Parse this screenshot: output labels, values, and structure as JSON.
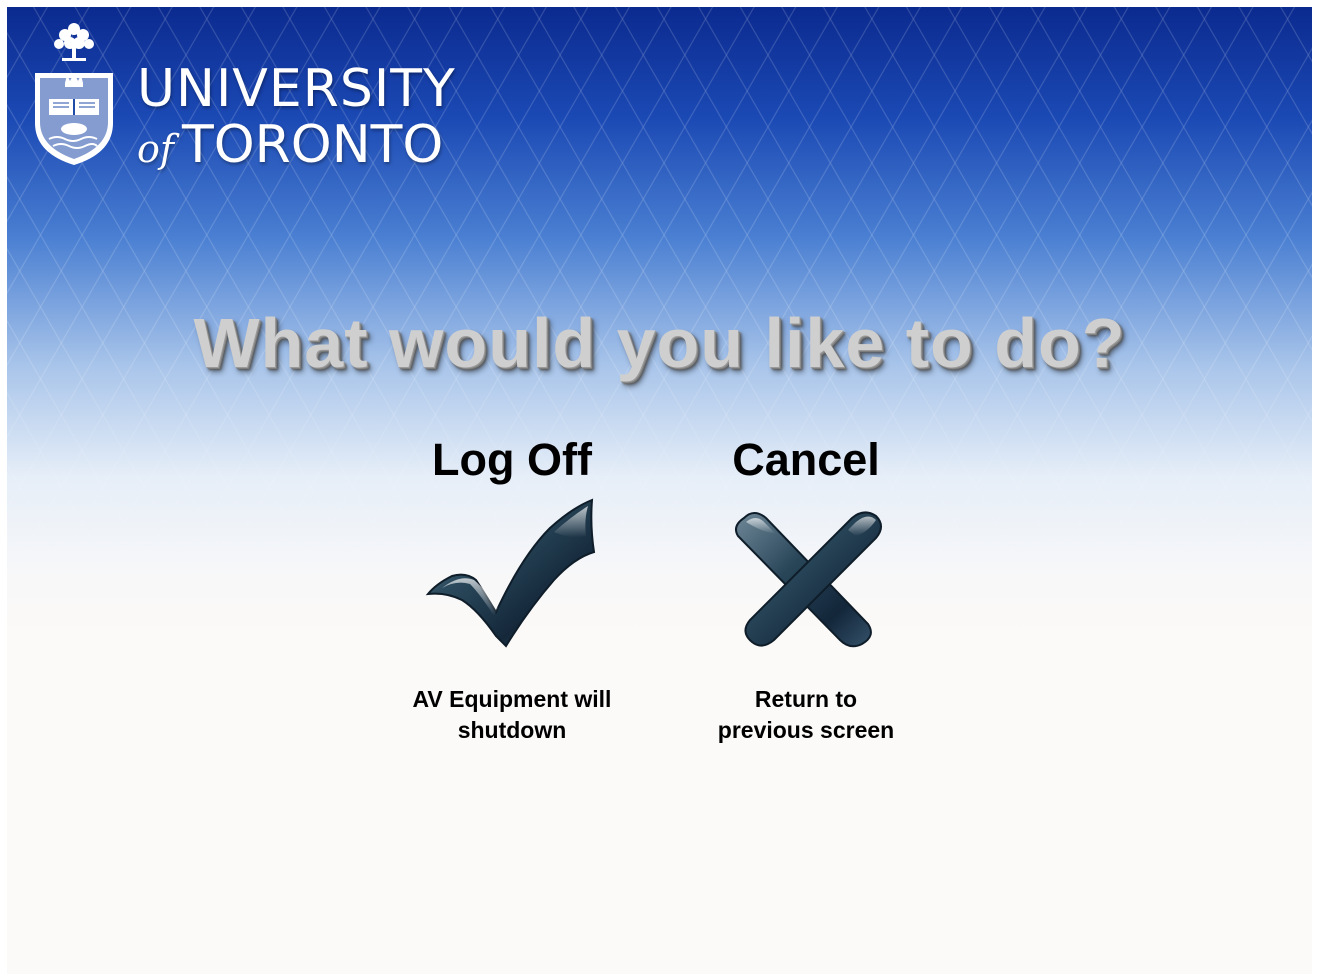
{
  "logo": {
    "line1": "UNIVERSITY",
    "of": "of",
    "line2": "TORONTO",
    "crest_icon": "university-crest-icon",
    "color": "#ffffff"
  },
  "headline": "What would you like to do?",
  "options": [
    {
      "title": "Log Off",
      "icon": "checkmark-icon",
      "caption_line1": "AV Equipment will",
      "caption_line2": "shutdown"
    },
    {
      "title": "Cancel",
      "icon": "x-mark-icon",
      "caption_line1": "Return to",
      "caption_line2": "previous screen"
    }
  ],
  "colors": {
    "background_top": "#0b2a8f",
    "background_bottom": "#fcfaf8",
    "icon_dark": "#1c3546",
    "headline": "#cfcfcf"
  }
}
